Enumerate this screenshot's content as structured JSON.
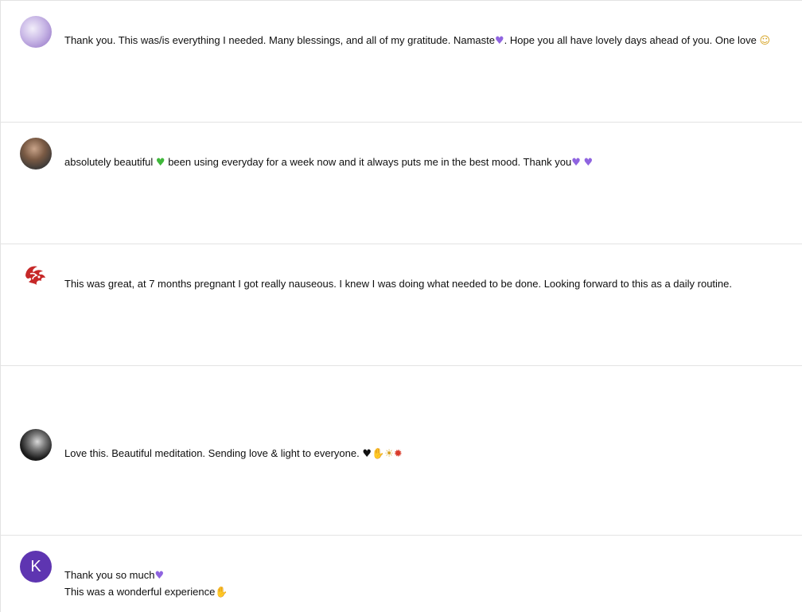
{
  "comments": [
    {
      "parts": [
        "Thank you. This was/is everything I needed. Many blessings, and all of my gratitude. Namaste",
        "♥",
        ". Hope you all have lovely days ahead of you. One love ",
        "☺"
      ]
    },
    {
      "parts": [
        "absolutely beautiful ",
        "♥",
        " been using everyday for a week now and it always puts me in the best mood. Thank you",
        "♥",
        " ",
        "♥"
      ]
    },
    {
      "text": "This was great, at 7 months pregnant I got really nauseous. I knew I was doing what needed to be done. Looking forward to this as a daily routine."
    },
    {
      "parts": [
        "Love this. Beautiful meditation. Sending love & light to everyone. ",
        "♥",
        "✋",
        "☀",
        "✹"
      ]
    },
    {
      "avatar_letter": "K",
      "line1": [
        "Thank you so much",
        "♥"
      ],
      "line2": [
        "This was a wonderful experience",
        "✋"
      ]
    }
  ],
  "colors": {
    "avatar_letter_bg": "#5e35b1",
    "purple_heart": "#8f64e0",
    "green_heart": "#3fb83a"
  }
}
